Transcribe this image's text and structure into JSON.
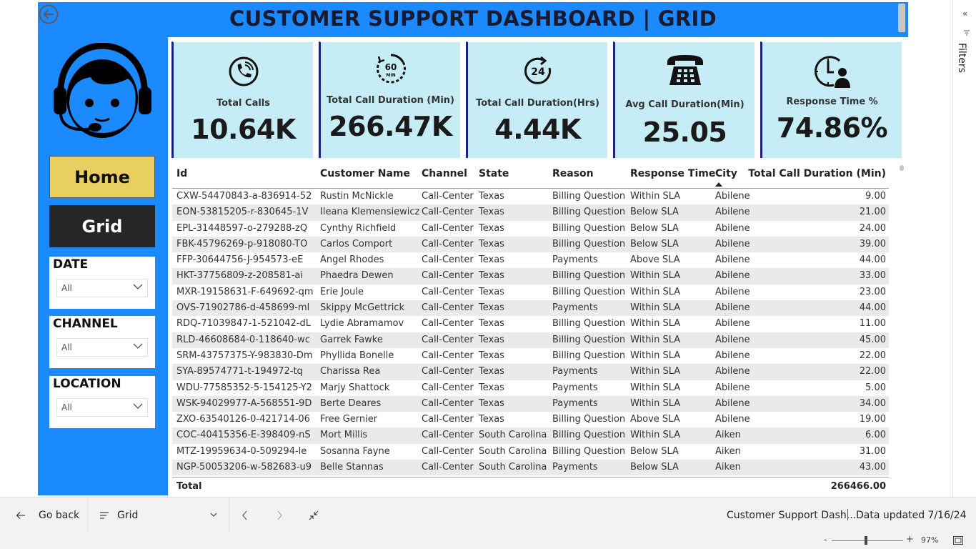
{
  "report": {
    "title": "CUSTOMER SUPPORT DASHBOARD | GRID"
  },
  "nav": {
    "home_label": "Home",
    "grid_label": "Grid"
  },
  "slicers": {
    "date": {
      "title": "DATE",
      "value": "All"
    },
    "channel": {
      "title": "CHANNEL",
      "value": "All"
    },
    "location": {
      "title": "LOCATION",
      "value": "All"
    }
  },
  "kpis": [
    {
      "label": "Total Calls",
      "value": "10.64K",
      "icon": "phone-call-icon"
    },
    {
      "label": "Total Call Duration (Min)",
      "value": "266.47K",
      "icon": "sixty-min-timer-icon"
    },
    {
      "label": "Total Call Duration(Hrs)",
      "value": "4.44K",
      "icon": "twenty-four-hour-icon"
    },
    {
      "label": "Avg Call Duration(Min)",
      "value": "25.05",
      "icon": "telephone-icon"
    },
    {
      "label": "Response Time %",
      "value": "74.86%",
      "icon": "clock-person-icon"
    }
  ],
  "table": {
    "headers": [
      "Id",
      "Customer Name",
      "Channel",
      "State",
      "Reason",
      "Response Time",
      "City",
      "Total Call Duration (Min)"
    ],
    "sorted_column": "City",
    "rows": [
      [
        "CXW-54470843-a-836914-52",
        "Rustin McNickle",
        "Call-Center",
        "Texas",
        "Billing Question",
        "Within SLA",
        "Abilene",
        "9.00"
      ],
      [
        "EON-53815205-r-830645-1V",
        "Ileana Klemensiewicz",
        "Call-Center",
        "Texas",
        "Billing Question",
        "Below SLA",
        "Abilene",
        "21.00"
      ],
      [
        "EPL-31448597-o-279288-zQ",
        "Cynthy Richfield",
        "Call-Center",
        "Texas",
        "Billing Question",
        "Below SLA",
        "Abilene",
        "24.00"
      ],
      [
        "FBK-45796269-p-918080-TO",
        "Carlos Comport",
        "Call-Center",
        "Texas",
        "Billing Question",
        "Below SLA",
        "Abilene",
        "39.00"
      ],
      [
        "FFP-30644756-J-954573-eE",
        "Angel Rhodes",
        "Call-Center",
        "Texas",
        "Payments",
        "Above SLA",
        "Abilene",
        "44.00"
      ],
      [
        "HKT-37756809-z-208581-ai",
        "Phaedra Dewen",
        "Call-Center",
        "Texas",
        "Billing Question",
        "Within SLA",
        "Abilene",
        "33.00"
      ],
      [
        "MXR-19158631-F-649692-qm",
        "Erie Joule",
        "Call-Center",
        "Texas",
        "Billing Question",
        "Within SLA",
        "Abilene",
        "23.00"
      ],
      [
        "OVS-71902786-d-458699-ml",
        "Skippy McGettrick",
        "Call-Center",
        "Texas",
        "Payments",
        "Within SLA",
        "Abilene",
        "44.00"
      ],
      [
        "RDQ-71039847-1-521042-dL",
        "Lydie Abramamov",
        "Call-Center",
        "Texas",
        "Billing Question",
        "Within SLA",
        "Abilene",
        "11.00"
      ],
      [
        "RLD-46608684-0-118640-wc",
        "Garrek Fawke",
        "Call-Center",
        "Texas",
        "Billing Question",
        "Within SLA",
        "Abilene",
        "45.00"
      ],
      [
        "SRM-43757375-Y-983830-Dm",
        "Phyllida Bonelle",
        "Call-Center",
        "Texas",
        "Billing Question",
        "Within SLA",
        "Abilene",
        "22.00"
      ],
      [
        "SYA-89574771-t-194972-tq",
        "Charissa Rea",
        "Call-Center",
        "Texas",
        "Payments",
        "Within SLA",
        "Abilene",
        "22.00"
      ],
      [
        "WDU-77585352-5-154125-Y2",
        "Marjy Shattock",
        "Call-Center",
        "Texas",
        "Payments",
        "Within SLA",
        "Abilene",
        "5.00"
      ],
      [
        "WSK-94029977-A-568551-9D",
        "Berte Deares",
        "Call-Center",
        "Texas",
        "Payments",
        "Within SLA",
        "Abilene",
        "34.00"
      ],
      [
        "ZXO-63540126-0-421714-06",
        "Free Gernier",
        "Call-Center",
        "Texas",
        "Billing Question",
        "Above SLA",
        "Abilene",
        "19.00"
      ],
      [
        "COC-40415356-E-398409-nS",
        "Mort Millis",
        "Call-Center",
        "South Carolina",
        "Billing Question",
        "Within SLA",
        "Aiken",
        "6.00"
      ],
      [
        "MTZ-19959634-0-509294-le",
        "Sosanna Fayne",
        "Call-Center",
        "South Carolina",
        "Billing Question",
        "Below SLA",
        "Aiken",
        "31.00"
      ],
      [
        "NGP-50053206-w-582683-u9",
        "Belle Stannas",
        "Call-Center",
        "South Carolina",
        "Payments",
        "Below SLA",
        "Aiken",
        "43.00"
      ]
    ],
    "total_label": "Total",
    "total_value": "266466.00"
  },
  "filters_pane": {
    "label": "Filters"
  },
  "bottom_bar": {
    "go_back": "Go back",
    "page": "Grid",
    "report_name": "Customer Support Dash...",
    "data_updated": "Data updated 7/16/24",
    "zoom_minus": "-",
    "zoom_plus": "+",
    "zoom": "97%"
  },
  "colors": {
    "accent_blue": "#1b8aff",
    "kpi_bg": "#c6edf5",
    "home_btn": "#e8cf5f",
    "grid_btn": "#262626"
  }
}
